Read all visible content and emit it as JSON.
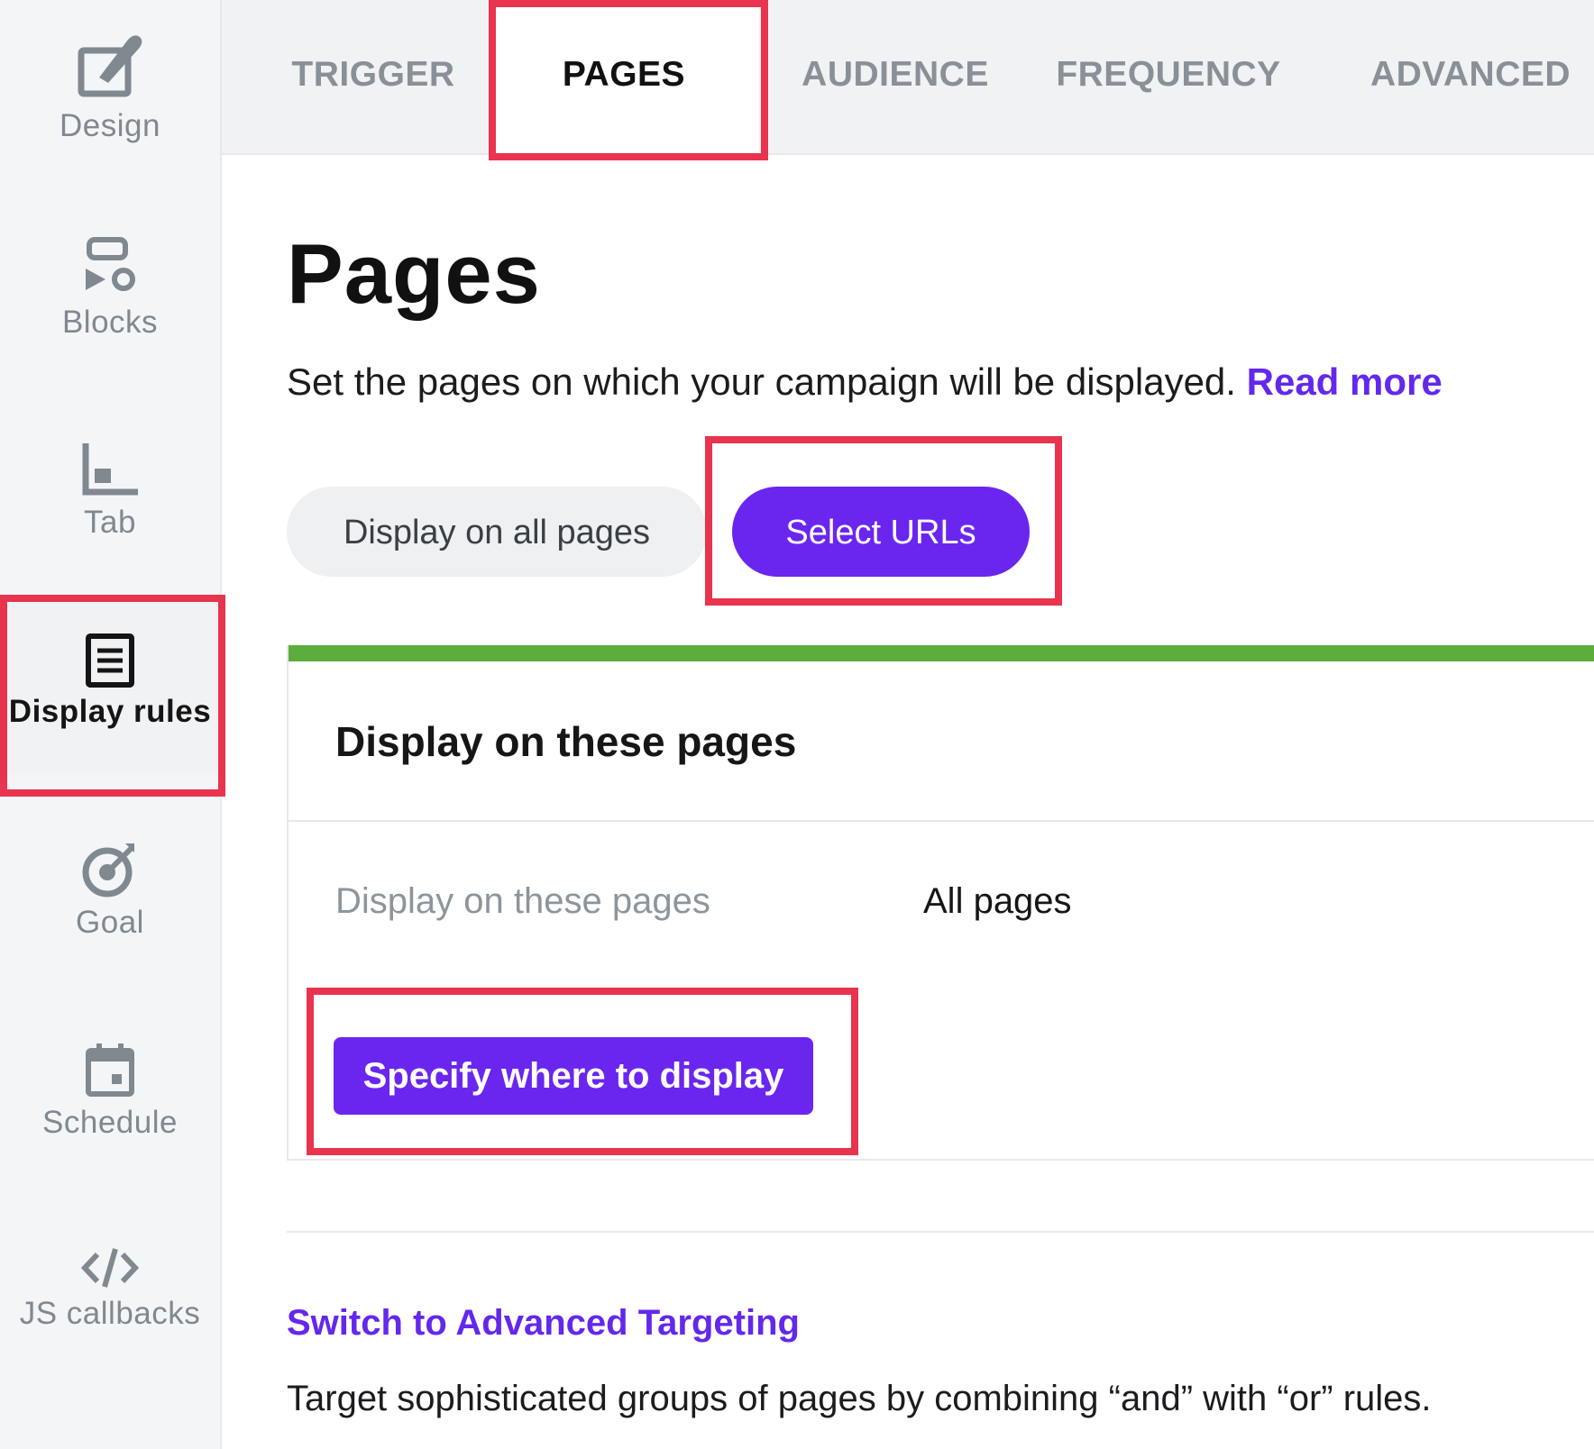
{
  "sidebar": {
    "items": [
      {
        "label": "Design",
        "icon": "design-brush-icon"
      },
      {
        "label": "Blocks",
        "icon": "blocks-icon"
      },
      {
        "label": "Tab",
        "icon": "tab-icon"
      },
      {
        "label": "Display rules",
        "icon": "document-list-icon",
        "active": true
      },
      {
        "label": "Goal",
        "icon": "target-icon"
      },
      {
        "label": "Schedule",
        "icon": "calendar-icon"
      },
      {
        "label": "JS callbacks",
        "icon": "code-icon"
      }
    ]
  },
  "tabs": [
    {
      "label": "TRIGGER"
    },
    {
      "label": "PAGES",
      "active": true
    },
    {
      "label": "AUDIENCE"
    },
    {
      "label": "FREQUENCY"
    },
    {
      "label": "ADVANCED"
    }
  ],
  "main": {
    "title": "Pages",
    "description": "Set the pages on which your campaign will be displayed.",
    "read_more": "Read more",
    "toggle": {
      "option_all": "Display on all pages",
      "option_select": "Select URLs",
      "selected": "Select URLs"
    },
    "card": {
      "title": "Display on these pages",
      "row_label": "Display on these pages",
      "row_value": "All pages",
      "button": "Specify where to display"
    },
    "advanced_link": "Switch to Advanced Targeting",
    "advanced_desc": "Target sophisticated groups of pages by combining “and” with “or” rules."
  },
  "colors": {
    "accent": "#6a26ef",
    "link": "#6428eb",
    "highlight": "#e8344e",
    "success_bar": "#5cad3e"
  }
}
